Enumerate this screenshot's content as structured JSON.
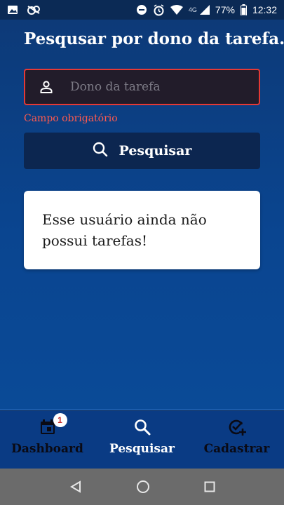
{
  "status_bar": {
    "network": "4G",
    "battery": "77%",
    "time": "12:32"
  },
  "page": {
    "title": "Pesqusar por dono da tarefa."
  },
  "search": {
    "placeholder": "Dono da tarefa",
    "value": "",
    "error": "Campo obrigatório",
    "button_label": "Pesquisar"
  },
  "result": {
    "message": "Esse usuário ainda não possui tarefas!"
  },
  "bottom_nav": {
    "items": [
      {
        "label": "Dashboard",
        "icon": "calendar-icon",
        "badge": "1"
      },
      {
        "label": "Pesquisar",
        "icon": "search-icon",
        "active": true
      },
      {
        "label": "Cadastrar",
        "icon": "add-task-icon"
      }
    ]
  },
  "colors": {
    "background": "#0a4590",
    "error": "#e53935",
    "button": "#0c2650",
    "card": "#ffffff"
  }
}
